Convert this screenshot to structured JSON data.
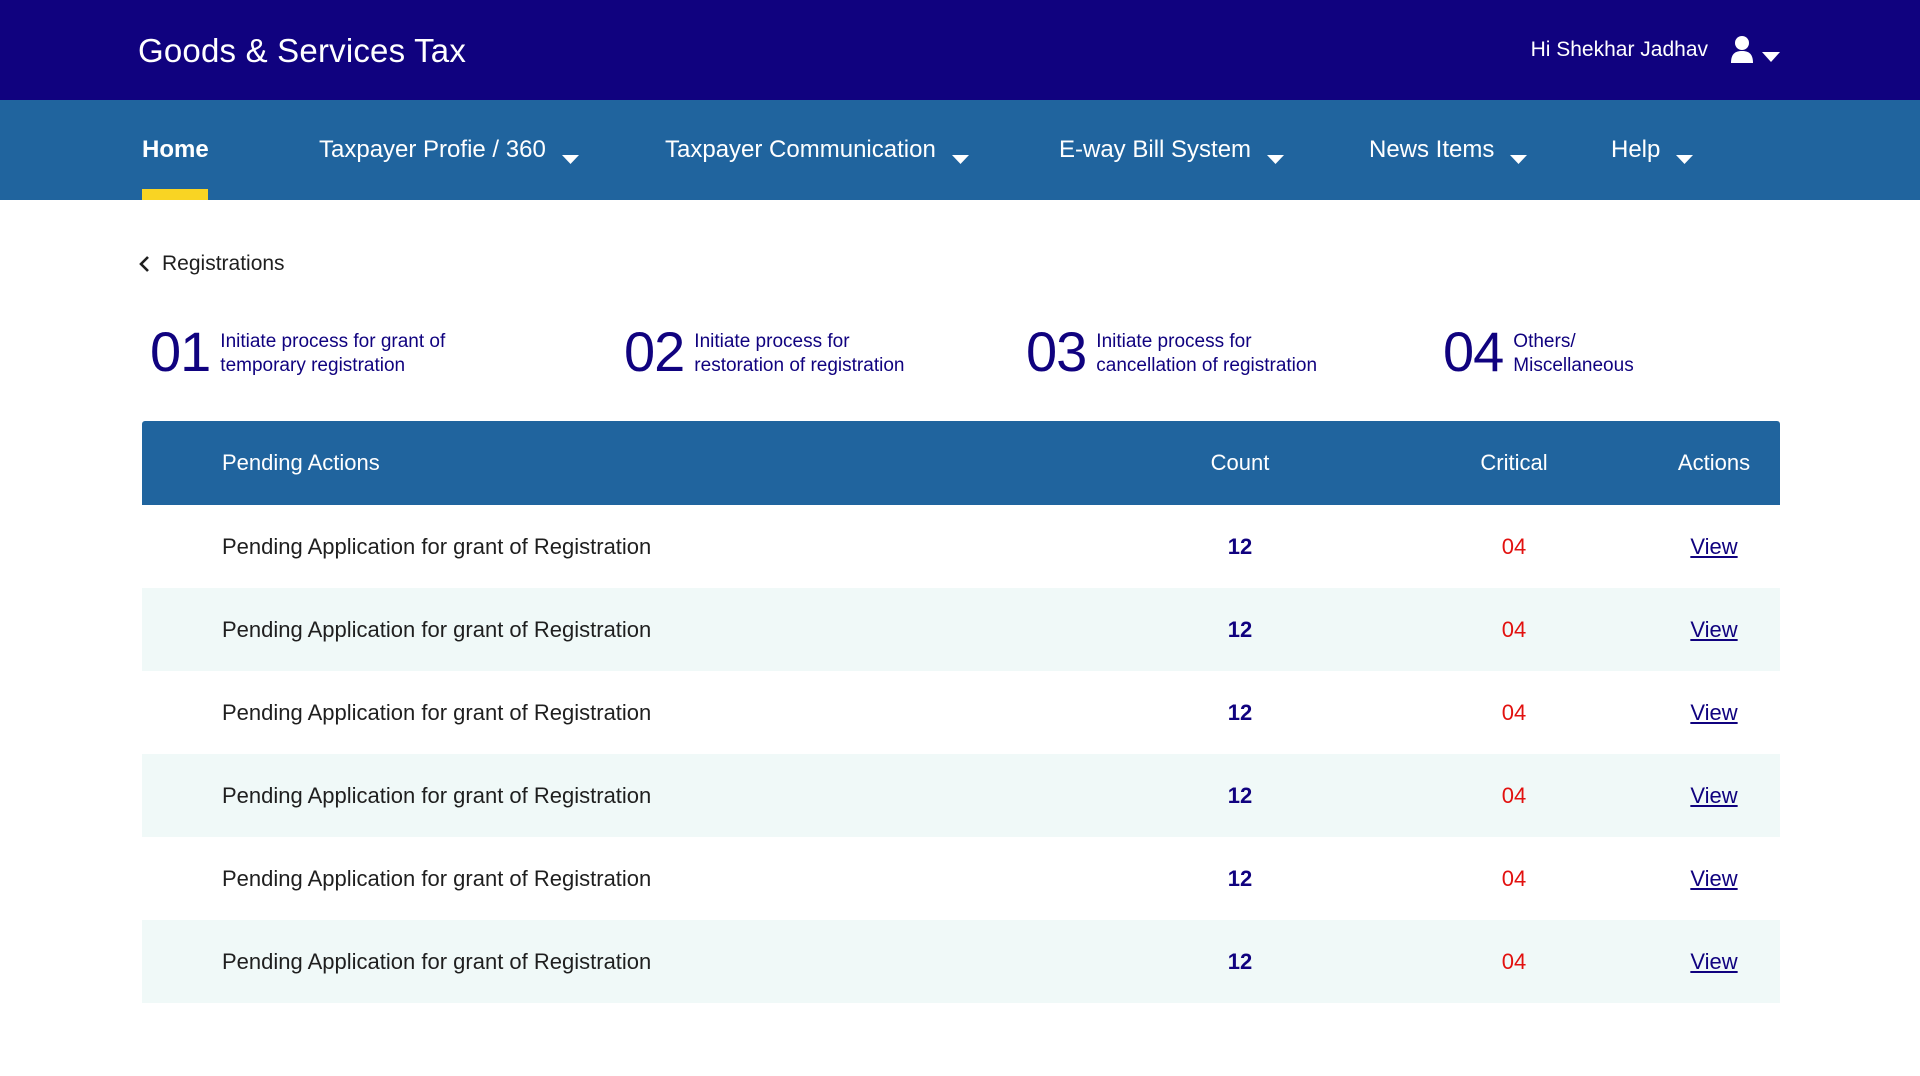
{
  "header": {
    "brand": "Goods & Services Tax",
    "greeting": "Hi Shekhar Jadhav",
    "user_icon": "user-icon",
    "colors": {
      "header_bg": "#10027f",
      "nav_bg": "#20649e",
      "active_underline": "#f9d423"
    }
  },
  "nav": {
    "items": [
      {
        "label": "Home",
        "active": true
      },
      {
        "label": "Taxpayer Profie / 360"
      },
      {
        "label": "Taxpayer Communication"
      },
      {
        "label": "E-way Bill System"
      },
      {
        "label": "News Items"
      },
      {
        "label": "Help"
      }
    ]
  },
  "breadcrumb": {
    "label": "Registrations",
    "icon": "chevron-left-icon"
  },
  "steps": [
    {
      "num": "01",
      "text": "Initiate process for grant of temporary registration"
    },
    {
      "num": "02",
      "text": "Initiate process for restoration of registration"
    },
    {
      "num": "03",
      "text": "Initiate process for cancellation of registration"
    },
    {
      "num": "04",
      "text": "Others/ Miscellaneous"
    }
  ],
  "table": {
    "headers": {
      "desc": "Pending Actions",
      "count": "Count",
      "critical": "Critical",
      "actions": "Actions"
    },
    "rows": [
      {
        "desc": "Pending Application for grant of Registration",
        "count": "12",
        "critical": "04",
        "action": "View"
      },
      {
        "desc": "Pending Application for grant of Registration",
        "count": "12",
        "critical": "04",
        "action": "View"
      },
      {
        "desc": "Pending Application for grant of Registration",
        "count": "12",
        "critical": "04",
        "action": "View"
      },
      {
        "desc": "Pending Application for grant of Registration",
        "count": "12",
        "critical": "04",
        "action": "View"
      },
      {
        "desc": "Pending Application for grant of Registration",
        "count": "12",
        "critical": "04",
        "action": "View"
      },
      {
        "desc": "Pending Application for grant of Registration",
        "count": "12",
        "critical": "04",
        "action": "View"
      }
    ],
    "colors": {
      "count": "#10027f",
      "critical": "#e2110f",
      "alt_row": "#f0f9f8"
    }
  }
}
